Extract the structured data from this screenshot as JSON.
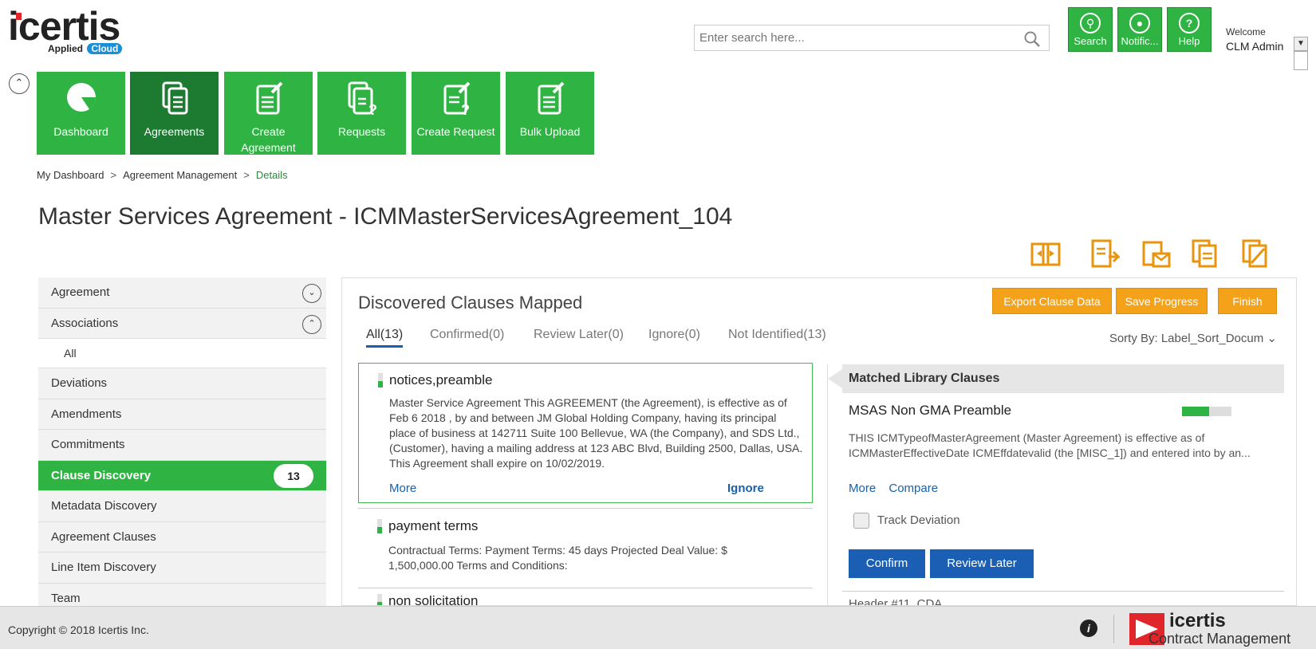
{
  "header": {
    "logo_word": "icertis",
    "logo_sub": "Applied",
    "logo_cloud": "Cloud",
    "search_placeholder": "Enter search here...",
    "buttons": [
      {
        "label": "Search",
        "icon": "search-icon"
      },
      {
        "label": "Notific...",
        "icon": "bell-icon"
      },
      {
        "label": "Help",
        "icon": "question-icon"
      }
    ],
    "welcome": "Welcome",
    "username": "CLM Admin"
  },
  "tiles": [
    {
      "label": "Dashboard",
      "icon": "pie-chart-icon",
      "active": false
    },
    {
      "label": "Agreements",
      "icon": "documents-icon",
      "active": true
    },
    {
      "label": "Create Agreement",
      "icon": "create-document-icon",
      "active": false
    },
    {
      "label": "Requests",
      "icon": "request-icon",
      "active": false
    },
    {
      "label": "Create Request",
      "icon": "create-request-icon",
      "active": false
    },
    {
      "label": "Bulk Upload",
      "icon": "upload-icon",
      "active": false
    }
  ],
  "breadcrumb": {
    "items": [
      "My Dashboard",
      "Agreement Management",
      "Details"
    ],
    "separator": ">"
  },
  "page_title": "Master Services Agreement - ICMMasterServicesAgreement_104",
  "sidebar": {
    "items": [
      {
        "label": "Agreement",
        "type": "section",
        "chevron": "down"
      },
      {
        "label": "Associations",
        "type": "section",
        "chevron": "up"
      },
      {
        "label": "All",
        "type": "sub"
      },
      {
        "label": "Deviations",
        "type": "item"
      },
      {
        "label": "Amendments",
        "type": "item"
      },
      {
        "label": "Commitments",
        "type": "item"
      },
      {
        "label": "Clause Discovery",
        "type": "active",
        "badge": "13"
      },
      {
        "label": "Metadata Discovery",
        "type": "item"
      },
      {
        "label": "Agreement Clauses",
        "type": "item"
      },
      {
        "label": "Line Item Discovery",
        "type": "item"
      },
      {
        "label": "Team",
        "type": "item"
      }
    ]
  },
  "main": {
    "title": "Discovered Clauses Mapped",
    "buttons": {
      "export": "Export Clause Data",
      "save": "Save Progress",
      "finish": "Finish"
    },
    "tabs": [
      "All(13)",
      "Confirmed(0)",
      "Review Later(0)",
      "Ignore(0)",
      "Not Identified(13)"
    ],
    "sort_by": "Sorty By: Label_Sort_Docum",
    "clauses": [
      {
        "title": "notices,preamble",
        "body": "Master Service Agreement This AGREEMENT (the Agreement), is effective as of Feb 6 2018 , by and between JM Global Holding Company, having its principal place of business at 142711 Suite 100 Bellevue, WA (the Company), and SDS Ltd., (Customer), having a mailing address at 123 ABC Blvd, Building 2500, Dallas, USA. This Agreement shall expire on 10/02/2019.",
        "more": "More",
        "ignore": "Ignore"
      },
      {
        "title": "payment terms",
        "body": "Contractual Terms: Payment Terms: 45 days Projected Deal Value: $ 1,500,000.00 Terms and Conditions:"
      },
      {
        "title": "non solicitation"
      }
    ],
    "library": {
      "heading": "Matched Library Clauses",
      "title": "MSAS Non GMA Preamble",
      "match_fraction": 0.55,
      "body": "THIS ICMTypeofMasterAgreement (Master Agreement) is effective as of ICMMasterEffectiveDate ICMEffdatevalid (the [MISC_1]) and entered into by an...",
      "more": "More",
      "compare": "Compare",
      "track_deviation": "Track Deviation",
      "confirm": "Confirm",
      "review_later": "Review Later",
      "next_title": "Header #11_CDA"
    }
  },
  "footer": {
    "copyright": "Copyright © 2018 Icertis Inc.",
    "brand": "icertis",
    "product": "Contract Management"
  },
  "colors": {
    "green": "#2fb343",
    "dark_green": "#1d7a31",
    "orange": "#f4a21a",
    "blue": "#1a5fb4"
  }
}
